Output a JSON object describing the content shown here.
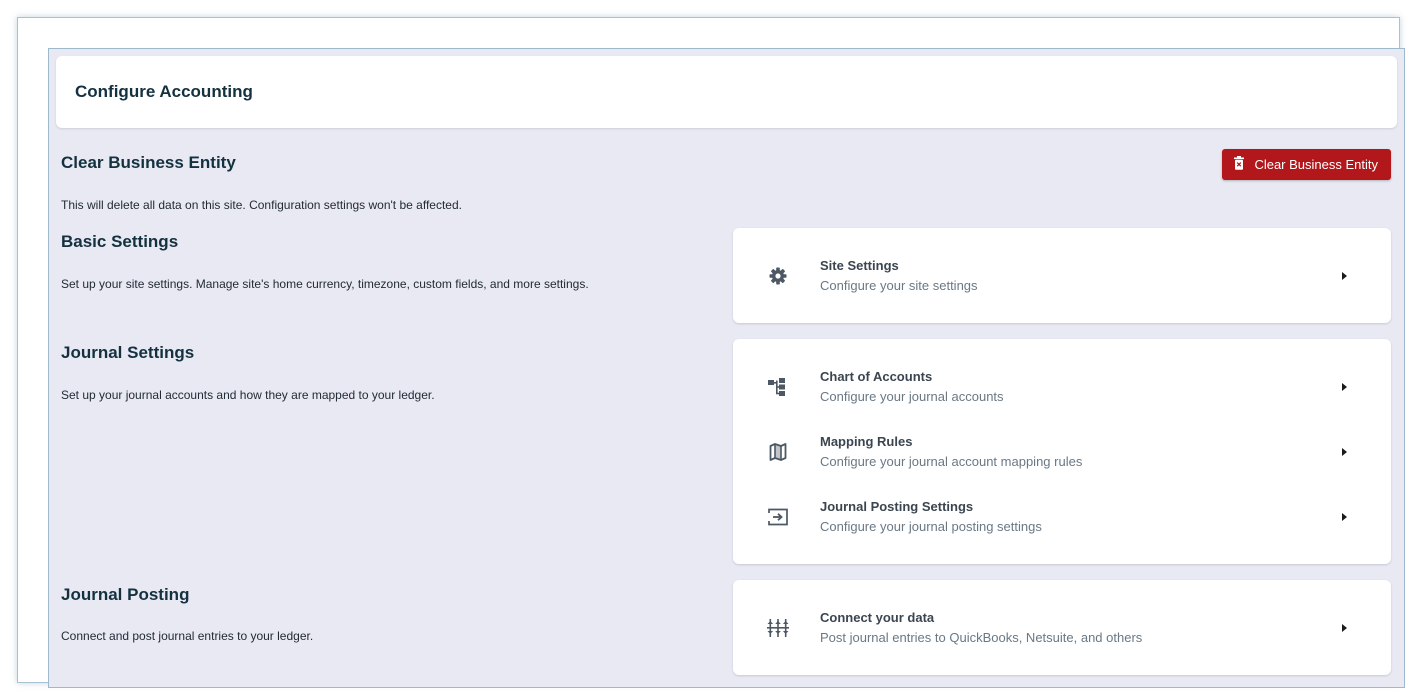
{
  "header": {
    "title": "Configure Accounting"
  },
  "clear_entity": {
    "title": "Clear Business Entity",
    "description": "This will delete all data on this site. Configuration settings won't be affected.",
    "button_label": "Clear Business Entity",
    "button_icon": "trash-icon",
    "button_color": "#b2171b"
  },
  "sections": {
    "basic": {
      "title": "Basic Settings",
      "description": "Set up your site settings. Manage site's home currency, timezone, custom fields, and more settings.",
      "items": [
        {
          "title": "Site Settings",
          "subtitle": "Configure your site settings",
          "icon": "gear-icon"
        }
      ]
    },
    "journal": {
      "title": "Journal Settings",
      "description": "Set up your journal accounts and how they are mapped to your ledger.",
      "items": [
        {
          "title": "Chart of Accounts",
          "subtitle": "Configure your journal accounts",
          "icon": "hierarchy-icon"
        },
        {
          "title": "Mapping Rules",
          "subtitle": "Configure your journal account mapping rules",
          "icon": "map-icon"
        },
        {
          "title": "Journal Posting Settings",
          "subtitle": "Configure your journal posting settings",
          "icon": "post-arrow-icon"
        }
      ]
    },
    "posting": {
      "title": "Journal Posting",
      "description": "Connect and post journal entries to your ledger.",
      "items": [
        {
          "title": "Connect your data",
          "subtitle": "Post journal entries to QuickBooks, Netsuite, and others",
          "icon": "connect-icon"
        }
      ]
    }
  },
  "colors": {
    "background": "#e9e9f4",
    "card": "#ffffff",
    "heading": "#14313f",
    "danger": "#b2171b"
  }
}
